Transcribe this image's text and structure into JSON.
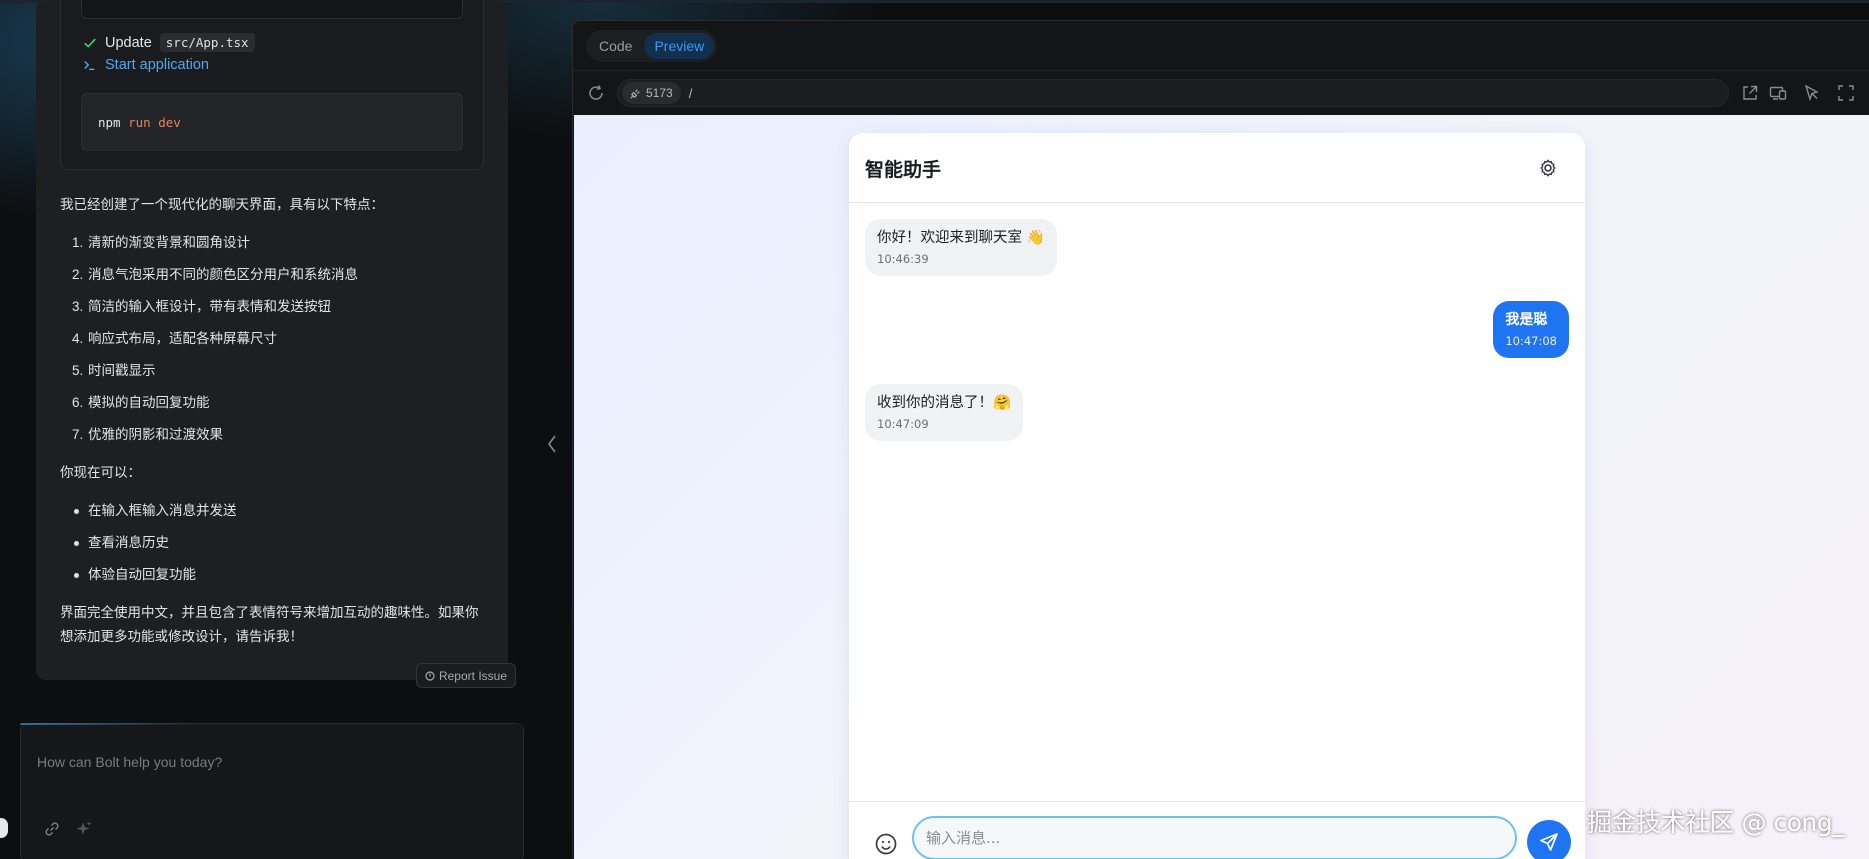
{
  "chat": {
    "steps": {
      "update_label": "Update",
      "update_file": "src/App.tsx",
      "start_label": "Start application",
      "command_prefix": "npm ",
      "command_keywords": "run dev"
    },
    "message": {
      "intro": "我已经创建了一个现代化的聊天界面，具有以下特点：",
      "features": [
        {
          "num": "1.",
          "text": "清新的渐变背景和圆角设计"
        },
        {
          "num": "2.",
          "text": "消息气泡采用不同的颜色区分用户和系统消息"
        },
        {
          "num": "3.",
          "text": "简洁的输入框设计，带有表情和发送按钮"
        },
        {
          "num": "4.",
          "text": "响应式布局，适配各种屏幕尺寸"
        },
        {
          "num": "5.",
          "text": "时间戳显示"
        },
        {
          "num": "6.",
          "text": "模拟的自动回复功能"
        },
        {
          "num": "7.",
          "text": "优雅的阴影和过渡效果"
        }
      ],
      "actions_intro": "你现在可以：",
      "actions": [
        "在输入框输入消息并发送",
        "查看消息历史",
        "体验自动回复功能"
      ],
      "closing": "界面完全使用中文，并且包含了表情符号来增加互动的趣味性。如果你想添加更多功能或修改设计，请告诉我！"
    },
    "report_issue": "Report Issue",
    "prompt_placeholder": "How can Bolt help you today?"
  },
  "workbench": {
    "tabs": [
      "Code",
      "Preview"
    ],
    "active_tab": "Preview",
    "port": "5173",
    "path": "/"
  },
  "preview": {
    "app_title": "智能助手",
    "messages": [
      {
        "role": "bot",
        "text": "你好！欢迎来到聊天室 👋",
        "time": "10:46:39"
      },
      {
        "role": "user",
        "text": "我是聪",
        "time": "10:47:08"
      },
      {
        "role": "bot",
        "text": "收到你的消息了！🤗",
        "time": "10:47:09"
      }
    ],
    "input_placeholder": "输入消息..."
  },
  "watermark": "掘金技术社区 @ cong_",
  "colors": {
    "accent": "#1f74f2",
    "link_blue": "#4ea8f0",
    "success_green": "#3ecf6e",
    "input_focus": "#6cc1f0"
  }
}
